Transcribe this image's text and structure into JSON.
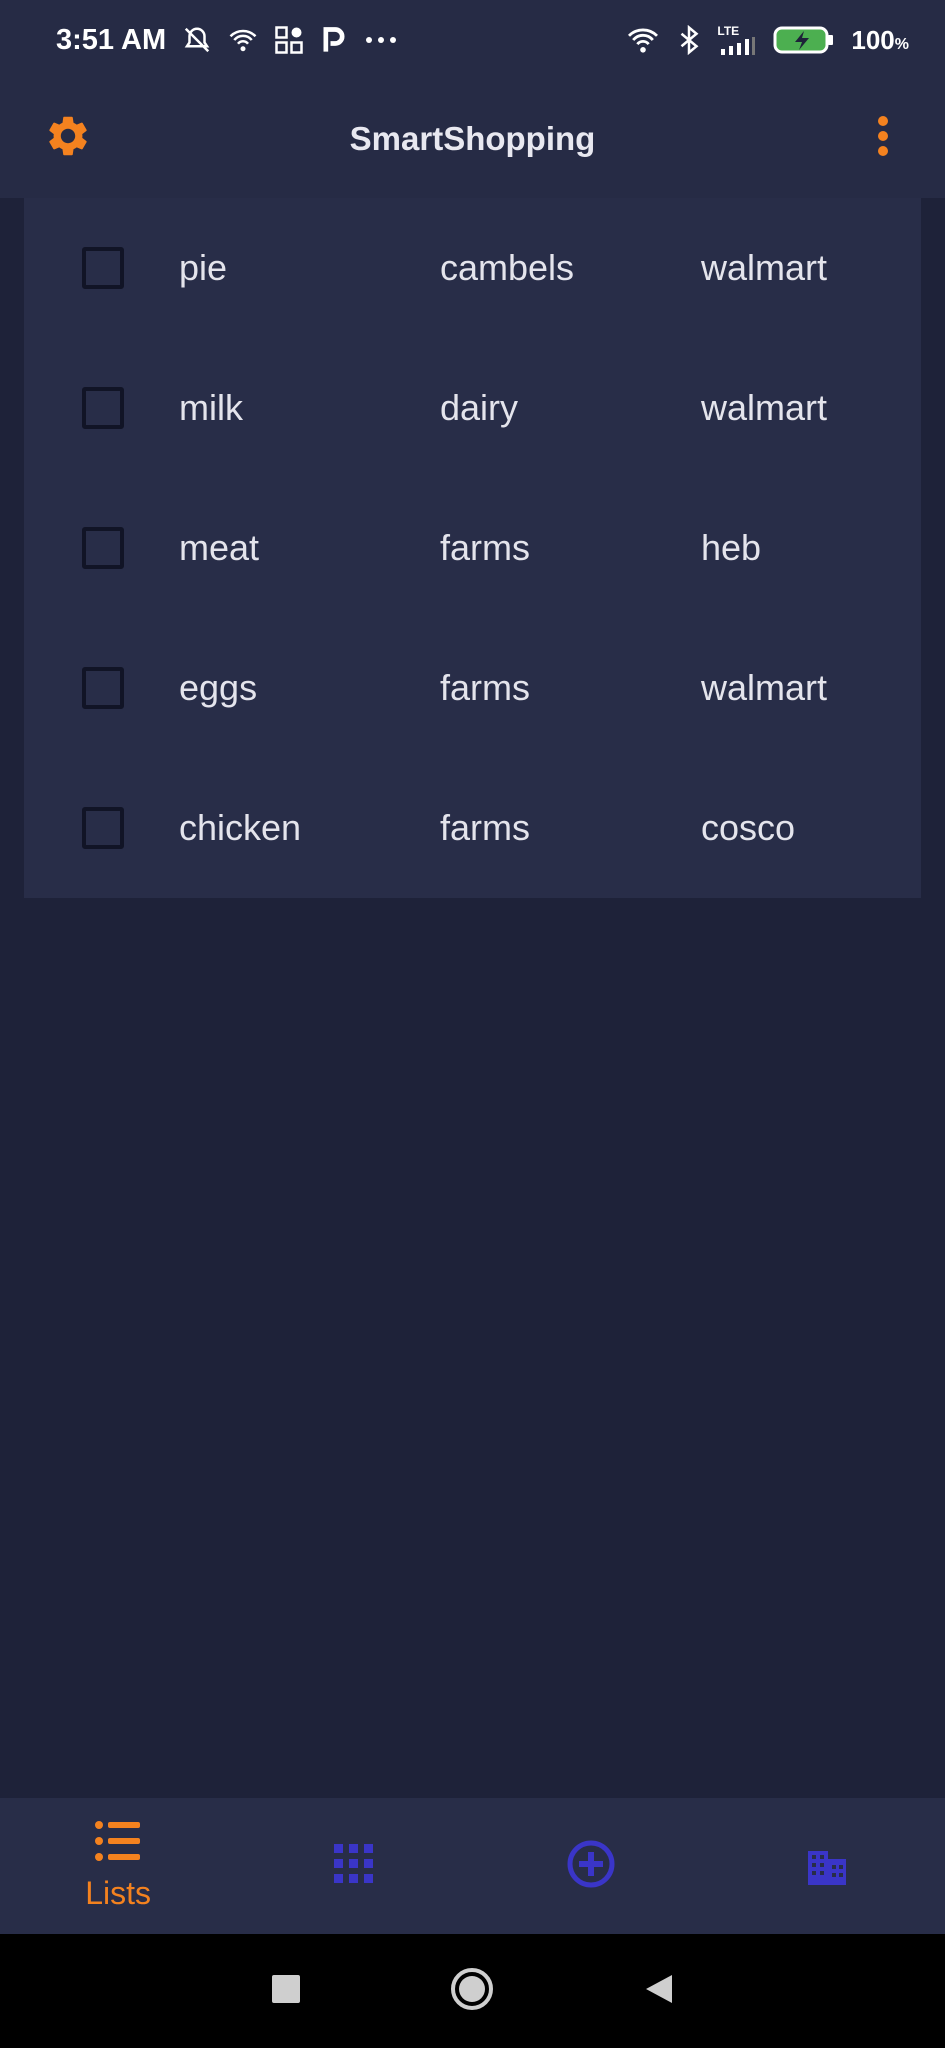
{
  "status_bar": {
    "time": "3:51 AM",
    "battery_percent": "100",
    "battery_unit": "%",
    "network_label": "LTE",
    "icons": [
      "alarm-off-icon",
      "wifi-icon",
      "apps-icon",
      "parking-icon",
      "more-dots-icon",
      "wifi-icon",
      "bluetooth-icon",
      "signal-icon",
      "battery-charging-icon"
    ]
  },
  "app_bar": {
    "title": "SmartShopping",
    "left_icon": "gear-icon",
    "right_icon": "more-vertical-icon"
  },
  "items": [
    {
      "name": "pie",
      "category": "cambels",
      "store": "walmart",
      "checked": false
    },
    {
      "name": "milk",
      "category": "dairy",
      "store": "walmart",
      "checked": false
    },
    {
      "name": "meat",
      "category": "farms",
      "store": "heb",
      "checked": false
    },
    {
      "name": "eggs",
      "category": "farms",
      "store": "walmart",
      "checked": false
    },
    {
      "name": "chicken",
      "category": "farms",
      "store": "cosco",
      "checked": false
    }
  ],
  "bottom_nav": {
    "tabs": [
      {
        "label": "Lists",
        "icon": "list-icon",
        "active": true
      },
      {
        "label": "",
        "icon": "grid-icon",
        "active": false
      },
      {
        "label": "",
        "icon": "add-circle-icon",
        "active": false
      },
      {
        "label": "",
        "icon": "building-icon",
        "active": false
      }
    ]
  },
  "colors": {
    "accent": "#f4821f",
    "inactive_icon": "#3a35c8",
    "background": "#1e2239",
    "surface": "#282d48"
  },
  "system_nav": {
    "buttons": [
      "square-recents-icon",
      "circle-home-icon",
      "triangle-back-icon"
    ]
  }
}
